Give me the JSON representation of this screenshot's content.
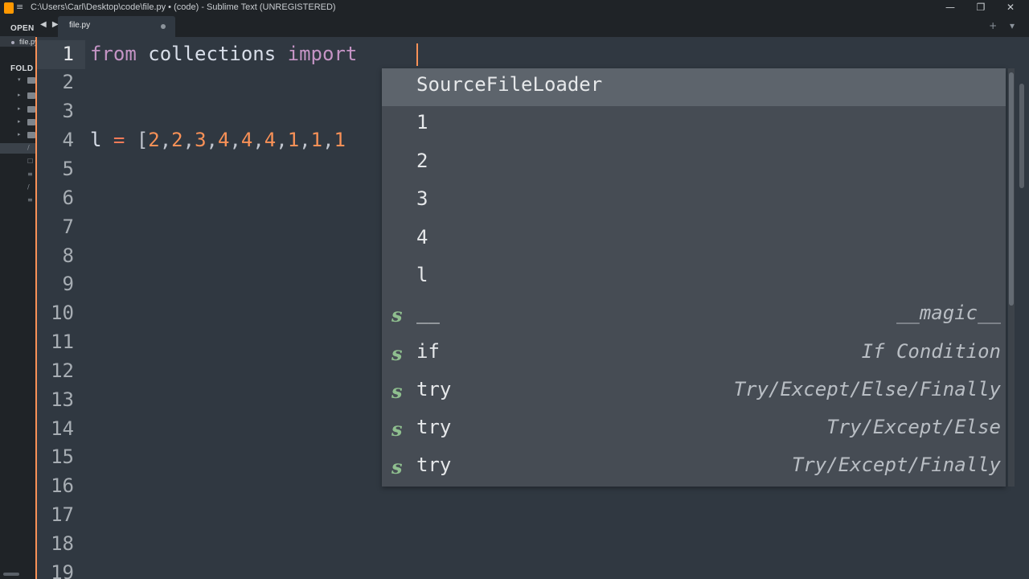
{
  "window": {
    "title": "C:\\Users\\Carl\\Desktop\\code\\file.py • (code) - Sublime Text (UNREGISTERED)",
    "controls": [
      "—",
      "❐",
      "✕"
    ]
  },
  "sidebar": {
    "open_header": "OPEN",
    "open_file": "file.py",
    "folders_header": "FOLD"
  },
  "tabs": [
    {
      "label": "file.py",
      "dirty": true
    }
  ],
  "tab_tools": "+ ▾",
  "nav_arrows": "◀ ▶",
  "editor": {
    "line_numbers": [
      "1",
      "2",
      "3",
      "4",
      "5",
      "6",
      "7",
      "8",
      "9",
      "10",
      "11",
      "12",
      "13",
      "14",
      "15",
      "16",
      "17",
      "18",
      "19"
    ],
    "active_line": 1,
    "line1": {
      "kw1": "from",
      "mod": " collections ",
      "kw2": "import",
      "rest": " "
    },
    "line4": {
      "var": "l",
      "eq": " = ",
      "open": "[",
      "items": [
        "2",
        ",",
        "2",
        ",",
        "3",
        ",",
        "4",
        ",",
        "4",
        ",",
        "4",
        ",",
        "1",
        ",",
        "1",
        ",",
        "1"
      ]
    }
  },
  "autocomplete": {
    "items": [
      {
        "kind": "",
        "trigger": "SourceFileLoader",
        "annotation": "",
        "selected": true
      },
      {
        "kind": "",
        "trigger": "1",
        "annotation": ""
      },
      {
        "kind": "",
        "trigger": "2",
        "annotation": ""
      },
      {
        "kind": "",
        "trigger": "3",
        "annotation": ""
      },
      {
        "kind": "",
        "trigger": "4",
        "annotation": ""
      },
      {
        "kind": "",
        "trigger": "l",
        "annotation": ""
      },
      {
        "kind": "s",
        "trigger": "__",
        "annotation": "__magic__"
      },
      {
        "kind": "s",
        "trigger": "if",
        "annotation": "If Condition"
      },
      {
        "kind": "s",
        "trigger": "try",
        "annotation": "Try/Except/Else/Finally"
      },
      {
        "kind": "s",
        "trigger": "try",
        "annotation": "Try/Except/Else"
      },
      {
        "kind": "s",
        "trigger": "try",
        "annotation": "Try/Except/Finally"
      }
    ]
  },
  "colors": {
    "background": "#303841",
    "accent": "#f99157",
    "keyword": "#c594c5",
    "snippet_kind": "#8fbf8f"
  }
}
